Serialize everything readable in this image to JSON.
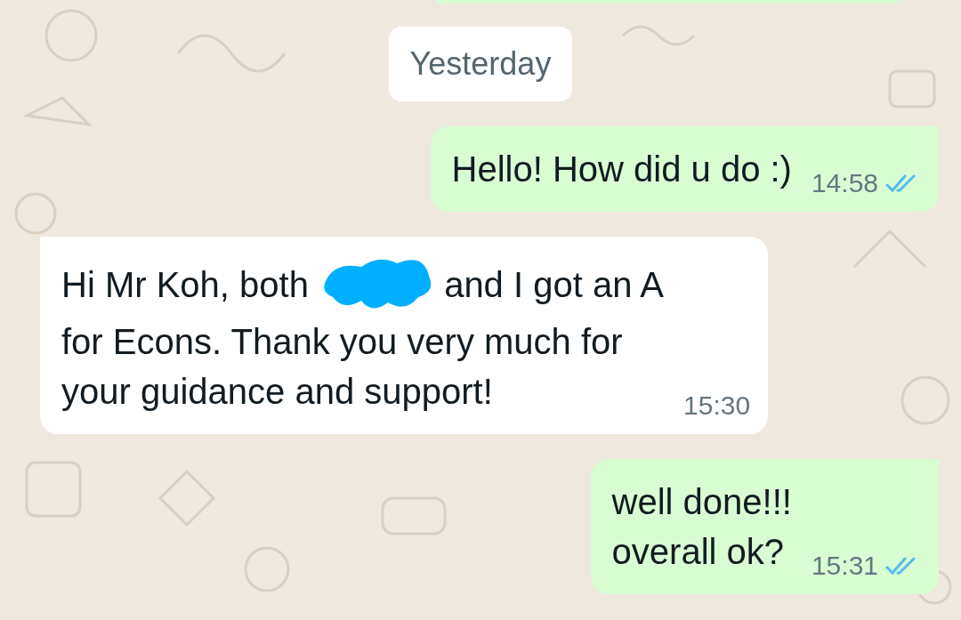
{
  "date_chip": "Yesterday",
  "messages": [
    {
      "kind": "outgoing",
      "segments": [
        {
          "kind": "text",
          "text": "Hello! How did u do :)"
        }
      ],
      "time": "14:58",
      "read": true
    },
    {
      "kind": "incoming",
      "segments": [
        {
          "kind": "text",
          "text": "Hi Mr Koh, both "
        },
        {
          "kind": "redacted"
        },
        {
          "kind": "text",
          "text": " and I got an A\nfor Econs. Thank you very much for\nyour guidance and support!"
        }
      ],
      "time": "15:30"
    },
    {
      "kind": "outgoing",
      "segments": [
        {
          "kind": "text",
          "text": "well done!!!\noverall ok?"
        }
      ],
      "time": "15:31",
      "read": true
    }
  ]
}
